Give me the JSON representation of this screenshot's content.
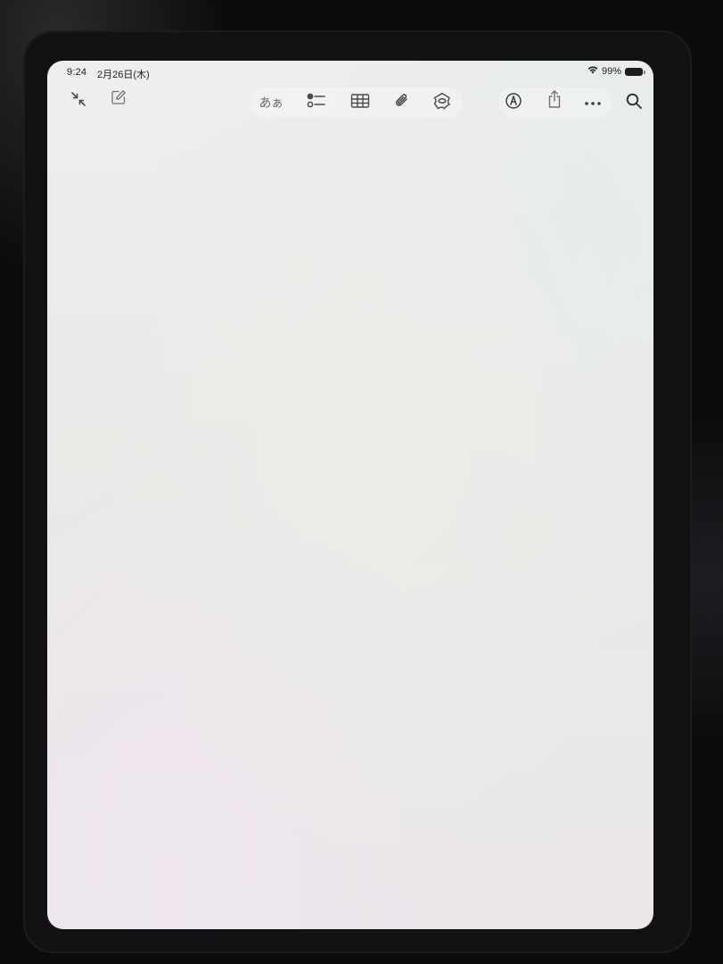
{
  "status_bar": {
    "time": "9:24",
    "date": "2月26日(木)",
    "battery_percent": "99%",
    "battery_level": 0.99,
    "wifi": true
  },
  "toolbar": {
    "left": [
      {
        "name": "collapse-icon",
        "action": "collapse"
      },
      {
        "name": "compose-icon",
        "action": "new note"
      }
    ],
    "center": [
      {
        "name": "format-text-icon",
        "label": "あぁ"
      },
      {
        "name": "checklist-icon"
      },
      {
        "name": "table-icon"
      },
      {
        "name": "attachment-icon"
      },
      {
        "name": "apple-intelligence-icon"
      }
    ],
    "right": [
      {
        "name": "markup-icon"
      },
      {
        "name": "share-icon"
      },
      {
        "name": "more-icon"
      },
      {
        "name": "search-icon"
      }
    ]
  },
  "note": {
    "content": ""
  },
  "colors": {
    "screen_background": "#ecece9",
    "icon_color": "#555558",
    "bezel": "#121214"
  }
}
